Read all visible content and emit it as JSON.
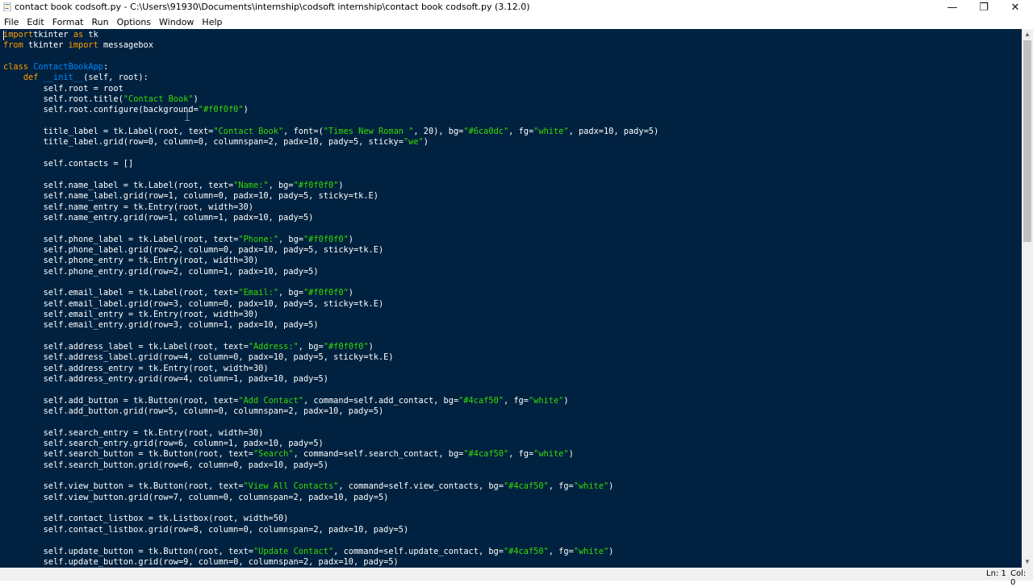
{
  "window": {
    "title": "contact book codsoft.py - C:\\Users\\91930\\Documents\\internship\\codsoft internship\\contact book codsoft.py (3.12.0)",
    "minimize": "—",
    "maximize": "❐",
    "close": "✕"
  },
  "menu": [
    "File",
    "Edit",
    "Format",
    "Run",
    "Options",
    "Window",
    "Help"
  ],
  "status": {
    "line": "Ln: 1",
    "col": "Col: 0"
  },
  "code_lines": [
    [
      [
        "kw",
        "import"
      ],
      [
        "",
        "tkinter "
      ],
      [
        "kw",
        "as"
      ],
      [
        "",
        " tk"
      ]
    ],
    [
      [
        "kw",
        "from"
      ],
      [
        "",
        "",
        " "
      ],
      [
        "",
        "tkinter "
      ],
      [
        "kw",
        "import"
      ],
      [
        "",
        " messagebox"
      ]
    ],
    [],
    [
      [
        "kw",
        "class"
      ],
      [
        "",
        " "
      ],
      [
        "cls",
        "ContactBookApp"
      ],
      [
        "",
        ":"
      ]
    ],
    [
      [
        "",
        "    "
      ],
      [
        "kw",
        "def"
      ],
      [
        "",
        " "
      ],
      [
        "fn",
        "__init__"
      ],
      [
        "",
        "(self, root):"
      ]
    ],
    [
      [
        "",
        "        self.root = root"
      ]
    ],
    [
      [
        "",
        "        self.root.title("
      ],
      [
        "str",
        "\"Contact Book\""
      ],
      [
        "",
        ")"
      ]
    ],
    [
      [
        "",
        "        self.root.configure(background="
      ],
      [
        "str",
        "\"#f0f0f0\""
      ],
      [
        "",
        ")"
      ]
    ],
    [],
    [
      [
        "",
        "        title_label = tk.Label(root, text="
      ],
      [
        "str",
        "\"Contact Book\""
      ],
      [
        "",
        ", font=("
      ],
      [
        "str",
        "\"Times New Roman \""
      ],
      [
        "",
        ", 20), bg="
      ],
      [
        "str",
        "\"#6ca0dc\""
      ],
      [
        "",
        ", fg="
      ],
      [
        "str",
        "\"white\""
      ],
      [
        "",
        ", padx=10, pady=5)"
      ]
    ],
    [
      [
        "",
        "        title_label.grid(row=0, column=0, columnspan=2, padx=10, pady=5, sticky="
      ],
      [
        "str",
        "\"we\""
      ],
      [
        "",
        ")"
      ]
    ],
    [],
    [
      [
        "",
        "        self.contacts = []"
      ]
    ],
    [],
    [
      [
        "",
        "        self.name_label = tk.Label(root, text="
      ],
      [
        "str",
        "\"Name:\""
      ],
      [
        "",
        ", bg="
      ],
      [
        "str",
        "\"#f0f0f0\""
      ],
      [
        "",
        ")"
      ]
    ],
    [
      [
        "",
        "        self.name_label.grid(row=1, column=0, padx=10, pady=5, sticky=tk.E)"
      ]
    ],
    [
      [
        "",
        "        self.name_entry = tk.Entry(root, width=30)"
      ]
    ],
    [
      [
        "",
        "        self.name_entry.grid(row=1, column=1, padx=10, pady=5)"
      ]
    ],
    [],
    [
      [
        "",
        "        self.phone_label = tk.Label(root, text="
      ],
      [
        "str",
        "\"Phone:\""
      ],
      [
        "",
        ", bg="
      ],
      [
        "str",
        "\"#f0f0f0\""
      ],
      [
        "",
        ")"
      ]
    ],
    [
      [
        "",
        "        self.phone_label.grid(row=2, column=0, padx=10, pady=5, sticky=tk.E)"
      ]
    ],
    [
      [
        "",
        "        self.phone_entry = tk.Entry(root, width=30)"
      ]
    ],
    [
      [
        "",
        "        self.phone_entry.grid(row=2, column=1, padx=10, pady=5)"
      ]
    ],
    [],
    [
      [
        "",
        "        self.email_label = tk.Label(root, text="
      ],
      [
        "str",
        "\"Email:\""
      ],
      [
        "",
        ", bg="
      ],
      [
        "str",
        "\"#f0f0f0\""
      ],
      [
        "",
        ")"
      ]
    ],
    [
      [
        "",
        "        self.email_label.grid(row=3, column=0, padx=10, pady=5, sticky=tk.E)"
      ]
    ],
    [
      [
        "",
        "        self.email_entry = tk.Entry(root, width=30)"
      ]
    ],
    [
      [
        "",
        "        self.email_entry.grid(row=3, column=1, padx=10, pady=5)"
      ]
    ],
    [],
    [
      [
        "",
        "        self.address_label = tk.Label(root, text="
      ],
      [
        "str",
        "\"Address:\""
      ],
      [
        "",
        ", bg="
      ],
      [
        "str",
        "\"#f0f0f0\""
      ],
      [
        "",
        ")"
      ]
    ],
    [
      [
        "",
        "        self.address_label.grid(row=4, column=0, padx=10, pady=5, sticky=tk.E)"
      ]
    ],
    [
      [
        "",
        "        self.address_entry = tk.Entry(root, width=30)"
      ]
    ],
    [
      [
        "",
        "        self.address_entry.grid(row=4, column=1, padx=10, pady=5)"
      ]
    ],
    [],
    [
      [
        "",
        "        self.add_button = tk.Button(root, text="
      ],
      [
        "str",
        "\"Add Contact\""
      ],
      [
        "",
        ", command=self.add_contact, bg="
      ],
      [
        "str",
        "\"#4caf50\""
      ],
      [
        "",
        ", fg="
      ],
      [
        "str",
        "\"white\""
      ],
      [
        "",
        ")"
      ]
    ],
    [
      [
        "",
        "        self.add_button.grid(row=5, column=0, columnspan=2, padx=10, pady=5)"
      ]
    ],
    [],
    [
      [
        "",
        "        self.search_entry = tk.Entry(root, width=30)"
      ]
    ],
    [
      [
        "",
        "        self.search_entry.grid(row=6, column=1, padx=10, pady=5)"
      ]
    ],
    [
      [
        "",
        "        self.search_button = tk.Button(root, text="
      ],
      [
        "str",
        "\"Search\""
      ],
      [
        "",
        ", command=self.search_contact, bg="
      ],
      [
        "str",
        "\"#4caf50\""
      ],
      [
        "",
        ", fg="
      ],
      [
        "str",
        "\"white\""
      ],
      [
        "",
        ")"
      ]
    ],
    [
      [
        "",
        "        self.search_button.grid(row=6, column=0, padx=10, pady=5)"
      ]
    ],
    [],
    [
      [
        "",
        "        self.view_button = tk.Button(root, text="
      ],
      [
        "str",
        "\"View All Contacts\""
      ],
      [
        "",
        ", command=self.view_contacts, bg="
      ],
      [
        "str",
        "\"#4caf50\""
      ],
      [
        "",
        ", fg="
      ],
      [
        "str",
        "\"white\""
      ],
      [
        "",
        ")"
      ]
    ],
    [
      [
        "",
        "        self.view_button.grid(row=7, column=0, columnspan=2, padx=10, pady=5)"
      ]
    ],
    [],
    [
      [
        "",
        "        self.contact_listbox = tk.Listbox(root, width=50)"
      ]
    ],
    [
      [
        "",
        "        self.contact_listbox.grid(row=8, column=0, columnspan=2, padx=10, pady=5)"
      ]
    ],
    [],
    [
      [
        "",
        "        self.update_button = tk.Button(root, text="
      ],
      [
        "str",
        "\"Update Contact\""
      ],
      [
        "",
        ", command=self.update_contact, bg="
      ],
      [
        "str",
        "\"#4caf50\""
      ],
      [
        "",
        ", fg="
      ],
      [
        "str",
        "\"white\""
      ],
      [
        "",
        ")"
      ]
    ],
    [
      [
        "",
        "        self.update_button.grid(row=9, column=0, columnspan=2, padx=10, pady=5)"
      ]
    ]
  ],
  "colors": {
    "editor_bg": "#002240",
    "keyword": "#ff9d00",
    "string": "#3ad900",
    "definition": "#0088ff",
    "text": "#ffffff"
  }
}
